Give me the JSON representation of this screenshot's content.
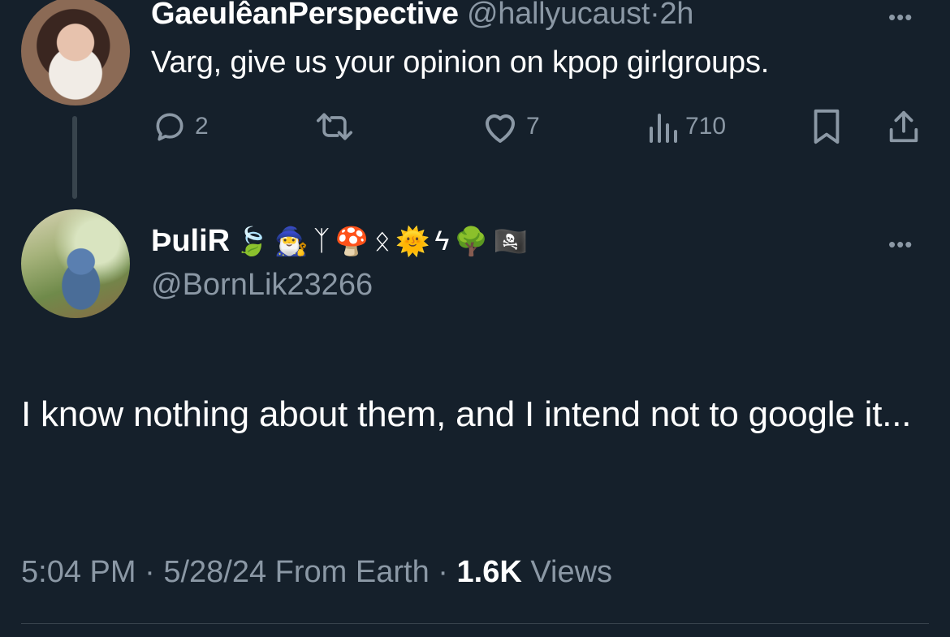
{
  "parent_tweet": {
    "display_name": "GaeulêanPerspective",
    "handle": "@hallyucaust",
    "separator": "·",
    "time": "2h",
    "text": "Varg, give us your opinion on kpop girlgroups.",
    "actions": {
      "reply_count": "2",
      "retweet_count": "",
      "like_count": "7",
      "views_count": "710"
    },
    "icons": [
      "reply-icon",
      "retweet-icon",
      "like-icon",
      "views-icon",
      "bookmark-icon",
      "share-icon",
      "more-icon"
    ]
  },
  "reply_tweet": {
    "display_name": "ÞuliR",
    "name_emojis": [
      "🍃",
      "🧙‍♂️",
      "ᛉ",
      "🍄",
      "ᛟ",
      "🌞",
      "ϟ",
      "🌳",
      "🏴‍☠️"
    ],
    "handle": "@BornLik23266",
    "text": "I know nothing about them, and I intend not to google it...",
    "footer": {
      "time": "5:04 PM",
      "sep1": "·",
      "date": "5/28/24",
      "source": "From Earth",
      "sep2": "·",
      "views_count": "1.6K",
      "views_label": "Views"
    }
  },
  "colors": {
    "background": "#15202b",
    "primary_text": "#ffffff",
    "secondary_text": "#8b98a5",
    "divider": "#38444d"
  }
}
